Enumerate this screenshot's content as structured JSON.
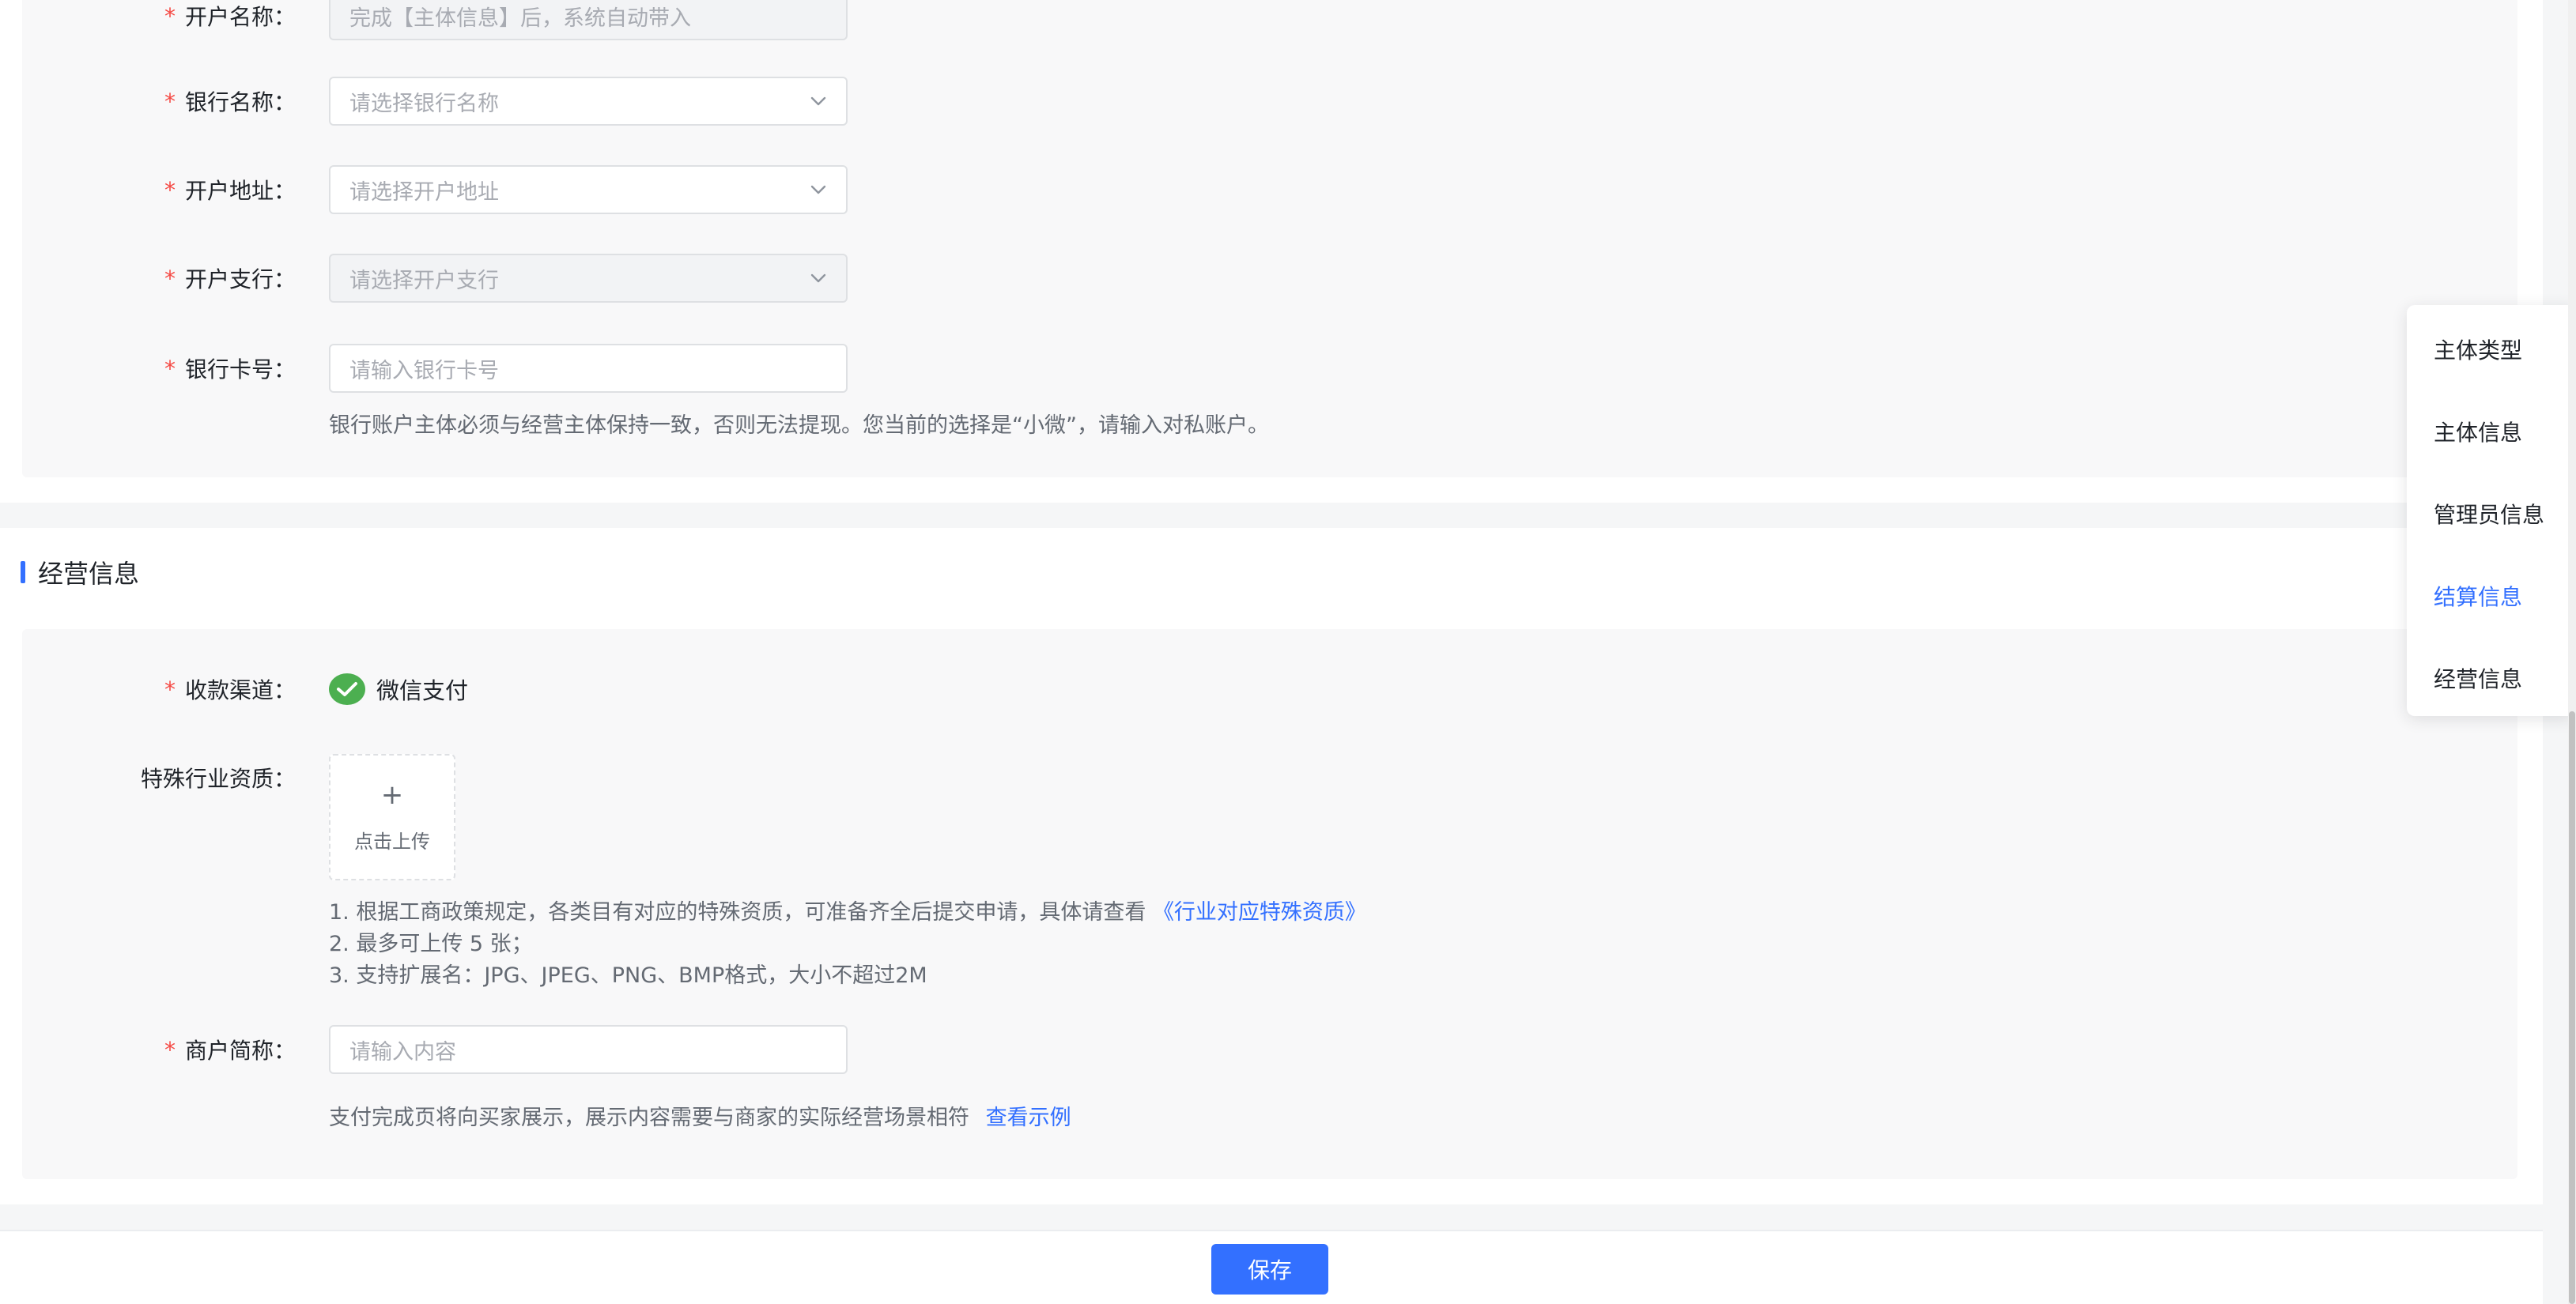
{
  "settlement": {
    "account_name": {
      "label": "开户名称：",
      "required": "*",
      "placeholder": "完成【主体信息】后，系统自动带入"
    },
    "bank_name": {
      "label": "银行名称：",
      "required": "*",
      "placeholder": "请选择银行名称"
    },
    "bank_address": {
      "label": "开户地址：",
      "required": "*",
      "placeholder": "请选择开户地址"
    },
    "bank_branch": {
      "label": "开户支行：",
      "required": "*",
      "placeholder": "请选择开户支行"
    },
    "card_number": {
      "label": "银行卡号：",
      "required": "*",
      "placeholder": "请输入银行卡号"
    },
    "hint": "银行账户主体必须与经营主体保持一致，否则无法提现。您当前的选择是“小微”，请输入对私账户。"
  },
  "business": {
    "section_title": "经营信息",
    "channel": {
      "label": "收款渠道：",
      "required": "*",
      "value": "微信支付",
      "icon": "wechat-pay-icon"
    },
    "qualification": {
      "label": "特殊行业资质：",
      "upload_plus": "+",
      "upload_text": "点击上传",
      "hint_line1": "1. 根据工商政策规定，各类目有对应的特殊资质，可准备齐全后提交申请，具体请查看",
      "hint_link": "《行业对应特殊资质》",
      "hint_line2": "2. 最多可上传 5 张；",
      "hint_line3": "3. 支持扩展名：JPG、JPEG、PNG、BMP格式，大小不超过2M"
    },
    "short_name": {
      "label": "商户简称：",
      "required": "*",
      "placeholder": "请输入内容",
      "hint": "支付完成页将向买家展示，展示内容需要与商家的实际经营场景相符",
      "hint_link": "查看示例"
    }
  },
  "footer": {
    "save_label": "保存"
  },
  "anchor_nav": {
    "items": [
      {
        "label": "主体类型",
        "active": false
      },
      {
        "label": "主体信息",
        "active": false
      },
      {
        "label": "管理员信息",
        "active": false
      },
      {
        "label": "结算信息",
        "active": true
      },
      {
        "label": "经营信息",
        "active": false
      }
    ]
  },
  "colors": {
    "accent": "#3370ff",
    "required": "#f54a45",
    "wechat": "#4caf50"
  }
}
